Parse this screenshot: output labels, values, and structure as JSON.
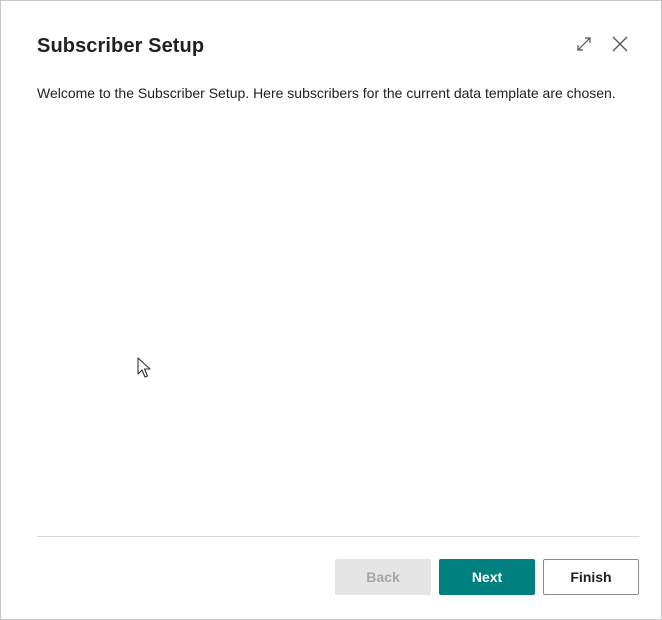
{
  "dialog": {
    "title": "Subscriber Setup",
    "welcome_text": "Welcome to the Subscriber Setup. Here subscribers for the current data template are chosen.",
    "icons": {
      "expand": "expand-icon",
      "close": "close-icon"
    }
  },
  "footer": {
    "back_label": "Back",
    "next_label": "Next",
    "finish_label": "Finish"
  },
  "colors": {
    "accent": "#00807f",
    "disabled_bg": "#e5e5e5",
    "disabled_text": "#a6a6a6"
  }
}
